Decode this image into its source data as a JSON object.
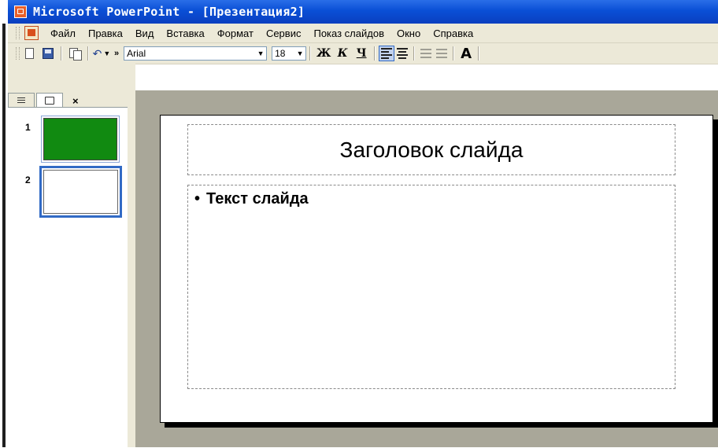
{
  "window": {
    "title": "Microsoft PowerPoint - [Презентация2]"
  },
  "menubar": {
    "items": [
      "Файл",
      "Правка",
      "Вид",
      "Вставка",
      "Формат",
      "Сервис",
      "Показ слайдов",
      "Окно",
      "Справка"
    ]
  },
  "toolbar": {
    "font_name": "Arial",
    "font_size": "18",
    "bold_label": "Ж",
    "italic_label": "К",
    "underline_label": "Ч",
    "more_label": "»",
    "grow_font_label": "A"
  },
  "slides_pane": {
    "close_label": "×",
    "slides": [
      {
        "number": "1"
      },
      {
        "number": "2"
      }
    ]
  },
  "slide": {
    "title": "Заголовок слайда",
    "bullet": "•",
    "body_text": "Текст слайда"
  },
  "colors": {
    "titlebar": "#0a4fd6",
    "thumbnail1_fill": "#118a11",
    "selection": "#316ac5"
  }
}
